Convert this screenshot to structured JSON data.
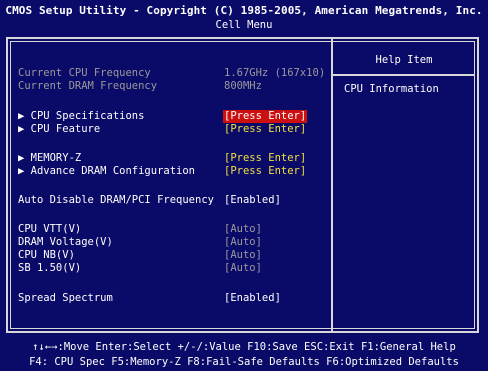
{
  "header": {
    "title": "CMOS Setup Utility - Copyright (C) 1985-2005, American Megatrends, Inc.",
    "menu": "Cell Menu"
  },
  "info": {
    "cpu_freq_label": "Current CPU Frequency",
    "cpu_freq_value": "1.67GHz (167x10)",
    "dram_freq_label": "Current DRAM Frequency",
    "dram_freq_value": "800MHz"
  },
  "items": {
    "cpu_spec": {
      "label": "▶ CPU Specifications",
      "value": "[Press Enter]"
    },
    "cpu_feature": {
      "label": "▶ CPU Feature",
      "value": "[Press Enter]"
    },
    "memory_z": {
      "label": "▶ MEMORY-Z",
      "value": "[Press Enter]"
    },
    "adv_dram": {
      "label": "▶ Advance DRAM Configuration",
      "value": "[Press Enter]"
    },
    "auto_disable": {
      "label": "Auto Disable DRAM/PCI Frequency",
      "value": "[Enabled]"
    },
    "cpu_vtt": {
      "label": "CPU VTT(V)",
      "value": "[Auto]"
    },
    "dram_voltage": {
      "label": "DRAM Voltage(V)",
      "value": "[Auto]"
    },
    "cpu_nb": {
      "label": "CPU NB(V)",
      "value": "[Auto]"
    },
    "sb_150": {
      "label": "SB 1.50(V)",
      "value": "[Auto]"
    },
    "spread_spectrum": {
      "label": "Spread Spectrum",
      "value": "[Enabled]"
    }
  },
  "help": {
    "title": "Help Item",
    "text": "CPU Information"
  },
  "footer": {
    "line1": "↑↓←→:Move  Enter:Select  +/-/:Value  F10:Save  ESC:Exit  F1:General Help",
    "line2": "F4: CPU Spec  F5:Memory-Z  F8:Fail-Safe Defaults  F6:Optimized Defaults"
  },
  "colors": {
    "background": "#0a0a68",
    "highlight": "#cc1010",
    "value_yellow": "#f0e040",
    "disabled_gray": "#9a9a9a"
  }
}
